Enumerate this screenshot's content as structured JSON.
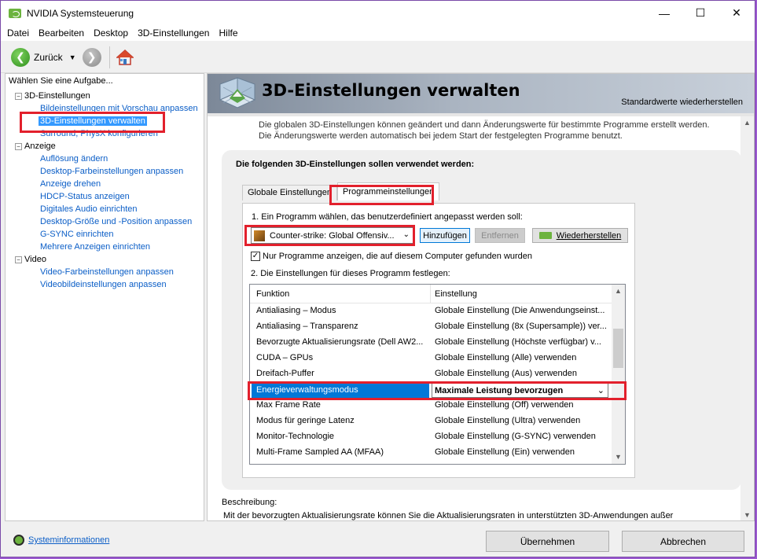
{
  "window": {
    "title": "NVIDIA Systemsteuerung"
  },
  "menu": [
    "Datei",
    "Bearbeiten",
    "Desktop",
    "3D-Einstellungen",
    "Hilfe"
  ],
  "toolbar": {
    "back_label": "Zurück"
  },
  "left": {
    "header": "Wählen Sie eine Aufgabe...",
    "tree": [
      {
        "type": "category",
        "label": "3D-Einstellungen"
      },
      {
        "type": "link",
        "label": "Bildeinstellungen mit Vorschau anpassen"
      },
      {
        "type": "link",
        "label": "3D-Einstellungen verwalten",
        "selected": true
      },
      {
        "type": "link",
        "label": "Surround, PhysX konfigurieren"
      },
      {
        "type": "category",
        "label": "Anzeige"
      },
      {
        "type": "link",
        "label": "Auflösung ändern"
      },
      {
        "type": "link",
        "label": "Desktop-Farbeinstellungen anpassen"
      },
      {
        "type": "link",
        "label": "Anzeige drehen"
      },
      {
        "type": "link",
        "label": "HDCP-Status anzeigen"
      },
      {
        "type": "link",
        "label": "Digitales Audio einrichten"
      },
      {
        "type": "link",
        "label": "Desktop-Größe und -Position anpassen"
      },
      {
        "type": "link",
        "label": "G-SYNC einrichten"
      },
      {
        "type": "link",
        "label": "Mehrere Anzeigen einrichten"
      },
      {
        "type": "category",
        "label": "Video"
      },
      {
        "type": "link",
        "label": "Video-Farbeinstellungen anpassen"
      },
      {
        "type": "link",
        "label": "Videobildeinstellungen anpassen"
      }
    ]
  },
  "bottom": {
    "sysinfo": "Systeminformationen",
    "apply": "Übernehmen",
    "cancel": "Abbrechen"
  },
  "main": {
    "title": "3D-Einstellungen verwalten",
    "restore_defaults": "Standardwerte wiederherstellen",
    "intro": "Die globalen 3D-Einstellungen können geändert und dann Änderungswerte für bestimmte Programme erstellt werden. Die Änderungswerte werden automatisch bei jedem Start der festgelegten Programme benutzt.",
    "group_title": "Die folgenden 3D-Einstellungen sollen verwendet werden:",
    "tabs": [
      "Globale Einstellungen",
      "Programmeinstellungen"
    ],
    "step1": "1. Ein Programm wählen, das benutzerdefiniert angepasst werden soll:",
    "program": "Counter-strike: Global Offensiv...",
    "add": "Hinzufügen",
    "remove": "Entfernen",
    "restore": "Wiederherstellen",
    "checkbox_label": "Nur Programme anzeigen, die auf diesem Computer gefunden wurden",
    "checkbox_checked": true,
    "step2": "2. Die Einstellungen für dieses Programm festlegen:",
    "columns": [
      "Funktion",
      "Einstellung"
    ],
    "rows": [
      {
        "f": "Antialiasing – Modus",
        "s": "Globale Einstellung (Die Anwendungseinst..."
      },
      {
        "f": "Antialiasing – Transparenz",
        "s": "Globale Einstellung (8x (Supersample)) ver..."
      },
      {
        "f": "Bevorzugte Aktualisierungsrate (Dell AW2...",
        "s": "Globale Einstellung (Höchste verfügbar) v..."
      },
      {
        "f": "CUDA – GPUs",
        "s": "Globale Einstellung (Alle) verwenden"
      },
      {
        "f": "Dreifach-Puffer",
        "s": "Globale Einstellung (Aus) verwenden"
      },
      {
        "f": "Energieverwaltungsmodus",
        "s": "Maximale Leistung bevorzugen",
        "selected": true
      },
      {
        "f": "Max Frame Rate",
        "s": "Globale Einstellung (Off) verwenden"
      },
      {
        "f": "Modus für geringe Latenz",
        "s": "Globale Einstellung (Ultra) verwenden"
      },
      {
        "f": "Monitor-Technologie",
        "s": "Globale Einstellung (G-SYNC) verwenden"
      },
      {
        "f": "Multi-Frame Sampled AA (MFAA)",
        "s": "Globale Einstellung (Ein) verwenden"
      }
    ],
    "desc_label": "Beschreibung:",
    "desc_text": "Mit der bevorzugten Aktualisierungsrate können Sie die Aktualisierungsraten in unterstützten 3D-Anwendungen außer"
  }
}
